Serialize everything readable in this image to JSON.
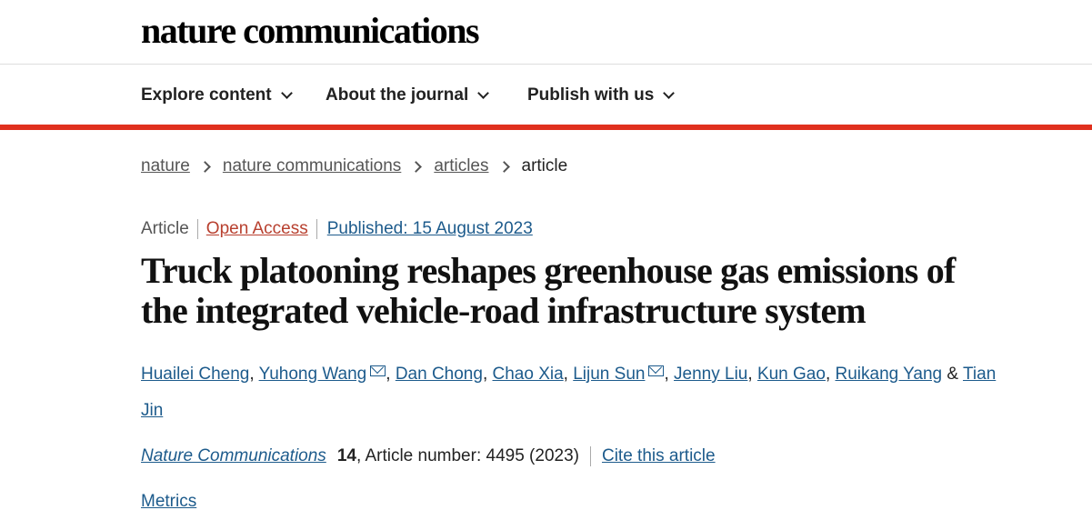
{
  "logo": "nature communications",
  "nav": {
    "items": [
      {
        "label": "Explore content"
      },
      {
        "label": "About the journal"
      },
      {
        "label": "Publish with us"
      }
    ]
  },
  "breadcrumb": [
    "nature",
    "nature communications",
    "articles",
    "article"
  ],
  "meta": {
    "type": "Article",
    "access": "Open Access",
    "published": "Published: 15 August 2023"
  },
  "title": "Truck platooning reshapes greenhouse gas emissions of the integrated vehicle-road infrastructure system",
  "authors": [
    {
      "name": "Huailei Cheng",
      "mail": false
    },
    {
      "name": "Yuhong Wang",
      "mail": true
    },
    {
      "name": "Dan Chong",
      "mail": false
    },
    {
      "name": "Chao Xia",
      "mail": false
    },
    {
      "name": "Lijun Sun",
      "mail": true
    },
    {
      "name": "Jenny Liu",
      "mail": false
    },
    {
      "name": "Kun Gao",
      "mail": false
    },
    {
      "name": "Ruikang Yang",
      "mail": false
    },
    {
      "name": "Tian Jin",
      "mail": false
    }
  ],
  "citation": {
    "journal": "Nature Communications",
    "volume": "14",
    "article_number": ", Article number: 4495 (2023)",
    "cite_label": "Cite this article"
  },
  "metrics_label": "Metrics",
  "colors": {
    "accent_red": "#e0301e",
    "link_blue": "#1d5b8c",
    "open_access": "#b8402f"
  },
  "icons": {
    "dropdown": "chevron-down-icon",
    "email": "envelope-icon",
    "breadcrumb_sep": "chevron-right-icon"
  }
}
